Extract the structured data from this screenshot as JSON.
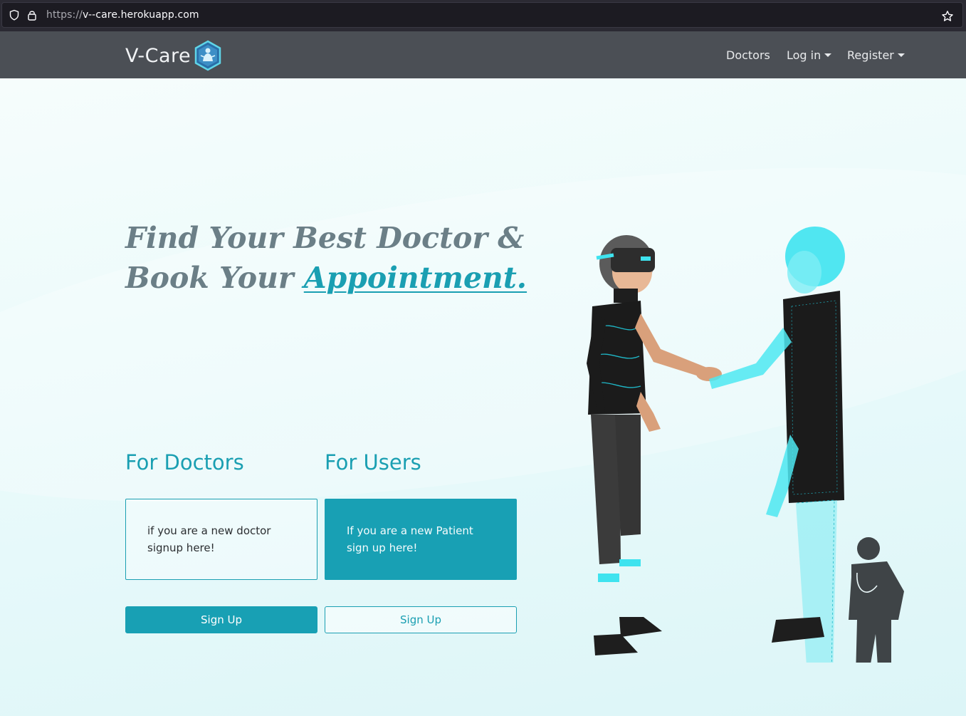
{
  "browser": {
    "url_protocol": "https://",
    "url_host": "v--care.herokuapp.com"
  },
  "navbar": {
    "brand": "V-Care",
    "links": [
      {
        "label": "Doctors",
        "dropdown": false
      },
      {
        "label": "Log in",
        "dropdown": true
      },
      {
        "label": "Register",
        "dropdown": true
      }
    ]
  },
  "hero": {
    "headline_line1": "Find Your Best Doctor &",
    "headline_line2_prefix": "Book Your ",
    "headline_line2_accent": "Appointment."
  },
  "doctors": {
    "title": "For Doctors",
    "card_text": "if you are a new doctor signup here!",
    "button_label": "Sign Up"
  },
  "users": {
    "title": "For Users",
    "card_text": "If you are a new Patient sign up here!",
    "button_label": "Sign Up"
  },
  "colors": {
    "accent": "#1a9fb2",
    "navbar": "#4b4f55",
    "headline": "#6b7f87"
  }
}
